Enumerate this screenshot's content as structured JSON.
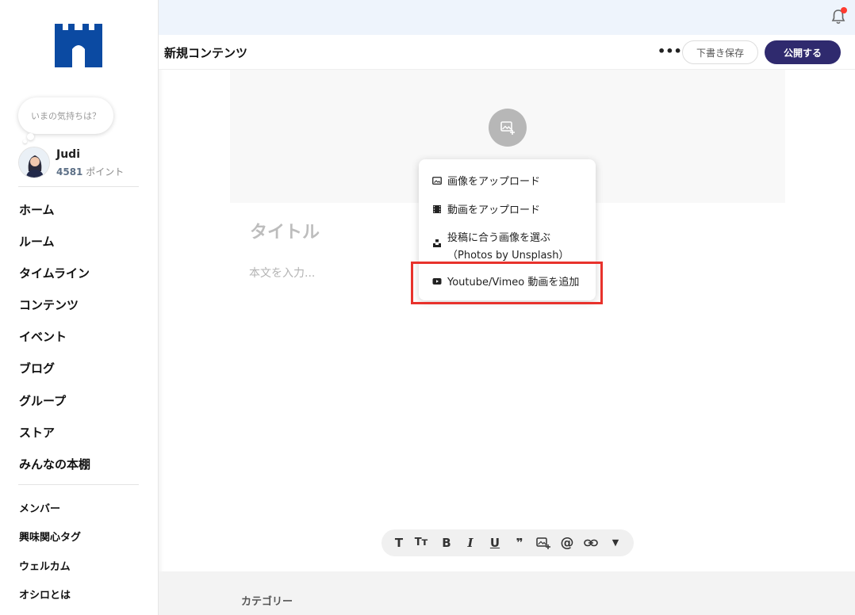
{
  "sidebar": {
    "mood_placeholder": "いまの気持ちは？",
    "user": {
      "name": "Judi",
      "points_value": "4581",
      "points_unit": "ポイント"
    },
    "nav": [
      "ホーム",
      "ルーム",
      "タイムライン",
      "コンテンツ",
      "イベント",
      "ブログ",
      "グループ",
      "ストア",
      "みんなの本棚"
    ],
    "subnav": [
      "メンバー",
      "興味関心タグ",
      "ウェルカム",
      "オシロとは"
    ]
  },
  "header": {
    "title": "新規コンテンツ",
    "more_label": "•••",
    "draft_button": "下書き保存",
    "publish_button": "公開する"
  },
  "editor": {
    "title_placeholder": "タイトル",
    "body_placeholder": "本文を入力..."
  },
  "media_menu": {
    "items": [
      {
        "label": "画像をアップロード",
        "icon": "image-icon"
      },
      {
        "label": "動画をアップロード",
        "icon": "film-icon"
      },
      {
        "label": "投稿に合う画像を選ぶ",
        "label2": "（Photos by Unsplash）",
        "icon": "unsplash-icon"
      },
      {
        "label": "Youtube/Vimeo 動画を追加",
        "icon": "youtube-icon"
      }
    ]
  },
  "toolbar": {
    "buttons": [
      "T",
      "Tт",
      "B",
      "I",
      "U",
      "❞",
      "image",
      "@",
      "link",
      "▼"
    ]
  },
  "footer": {
    "category_label": "カテゴリー"
  },
  "colors": {
    "accent": "#2f2a6e",
    "highlight": "#e8322c",
    "top_band": "#eef4fc",
    "logo": "#0b4aa2"
  }
}
